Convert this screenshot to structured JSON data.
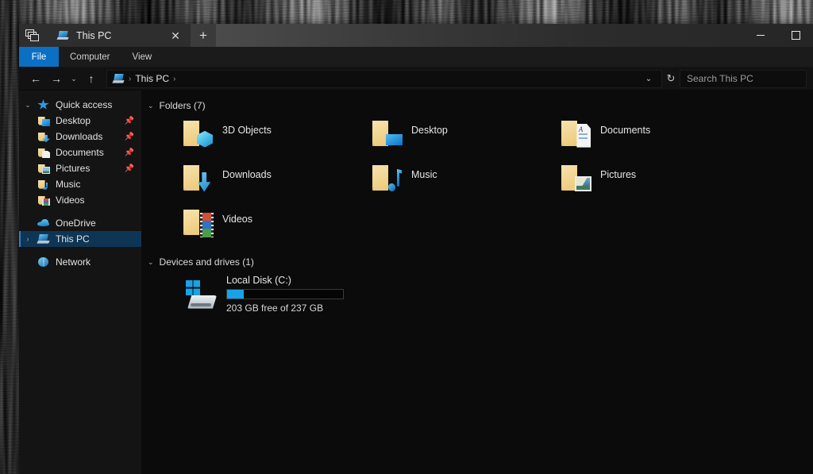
{
  "window": {
    "tab": {
      "title": "This PC",
      "icon": "this-pc-icon",
      "close_label": "✕",
      "new_tab_label": "+"
    },
    "controls": {
      "minimize_label": "—",
      "maximize_label": "▢"
    }
  },
  "ribbon": {
    "items": [
      {
        "label": "File",
        "active": true
      },
      {
        "label": "Computer",
        "active": false
      },
      {
        "label": "View",
        "active": false
      }
    ]
  },
  "addressbar": {
    "back_label": "←",
    "forward_label": "→",
    "recent_label": "⌄",
    "up_label": "↑",
    "breadcrumb": {
      "icon": "this-pc-icon",
      "text": "This PC",
      "separator": "›",
      "leading_separator": "›"
    },
    "dropdown_label": "⌄",
    "refresh_label": "↻",
    "search_placeholder": "Search This PC"
  },
  "sidebar": {
    "items": [
      {
        "label": "Quick access",
        "icon": "star-icon",
        "chevron": "⌄",
        "level": "root",
        "pinned": false,
        "selected": false
      },
      {
        "label": "Desktop",
        "icon": "folder-desktop-icon",
        "chevron": "",
        "level": "child",
        "pinned": true,
        "selected": false
      },
      {
        "label": "Downloads",
        "icon": "folder-downloads-icon",
        "chevron": "",
        "level": "child",
        "pinned": true,
        "selected": false
      },
      {
        "label": "Documents",
        "icon": "folder-documents-icon",
        "chevron": "",
        "level": "child",
        "pinned": true,
        "selected": false
      },
      {
        "label": "Pictures",
        "icon": "folder-pictures-icon",
        "chevron": "",
        "level": "child",
        "pinned": true,
        "selected": false
      },
      {
        "label": "Music",
        "icon": "folder-music-icon",
        "chevron": "",
        "level": "child",
        "pinned": false,
        "selected": false
      },
      {
        "label": "Videos",
        "icon": "folder-videos-icon",
        "chevron": "",
        "level": "child",
        "pinned": false,
        "selected": false
      },
      {
        "label": "OneDrive",
        "icon": "cloud-icon",
        "chevron": "",
        "level": "top",
        "pinned": false,
        "selected": false
      },
      {
        "label": "This PC",
        "icon": "this-pc-icon",
        "chevron": "›",
        "level": "top",
        "pinned": false,
        "selected": true
      },
      {
        "label": "Network",
        "icon": "network-globe-icon",
        "chevron": "",
        "level": "top",
        "pinned": false,
        "selected": false
      }
    ],
    "pin_glyph": "📌"
  },
  "content": {
    "groups": [
      {
        "title": "Folders (7)",
        "chevron": "⌄",
        "items": [
          {
            "label": "3D Objects",
            "icon": "folder-3d-objects-icon"
          },
          {
            "label": "Desktop",
            "icon": "folder-desktop-icon"
          },
          {
            "label": "Documents",
            "icon": "folder-documents-icon"
          },
          {
            "label": "Downloads",
            "icon": "folder-downloads-icon"
          },
          {
            "label": "Music",
            "icon": "folder-music-icon"
          },
          {
            "label": "Pictures",
            "icon": "folder-pictures-icon"
          },
          {
            "label": "Videos",
            "icon": "folder-videos-icon"
          }
        ]
      }
    ],
    "drives_group": {
      "title": "Devices and drives (1)",
      "chevron": "⌄",
      "drives": [
        {
          "name": "Local Disk (C:)",
          "icon": "hard-drive-windows-icon",
          "free_text": "203 GB free of 237 GB",
          "used_percent": 14.3,
          "bar_fill_color": "#17a3e8"
        }
      ]
    }
  },
  "colors": {
    "accent": "#0b6fc4",
    "selection": "#0f3554",
    "selection_bar": "#2f7fc4",
    "window_bg": "#0b0b0b",
    "sidebar_bg": "#141414",
    "text": "#e6e6e6"
  }
}
